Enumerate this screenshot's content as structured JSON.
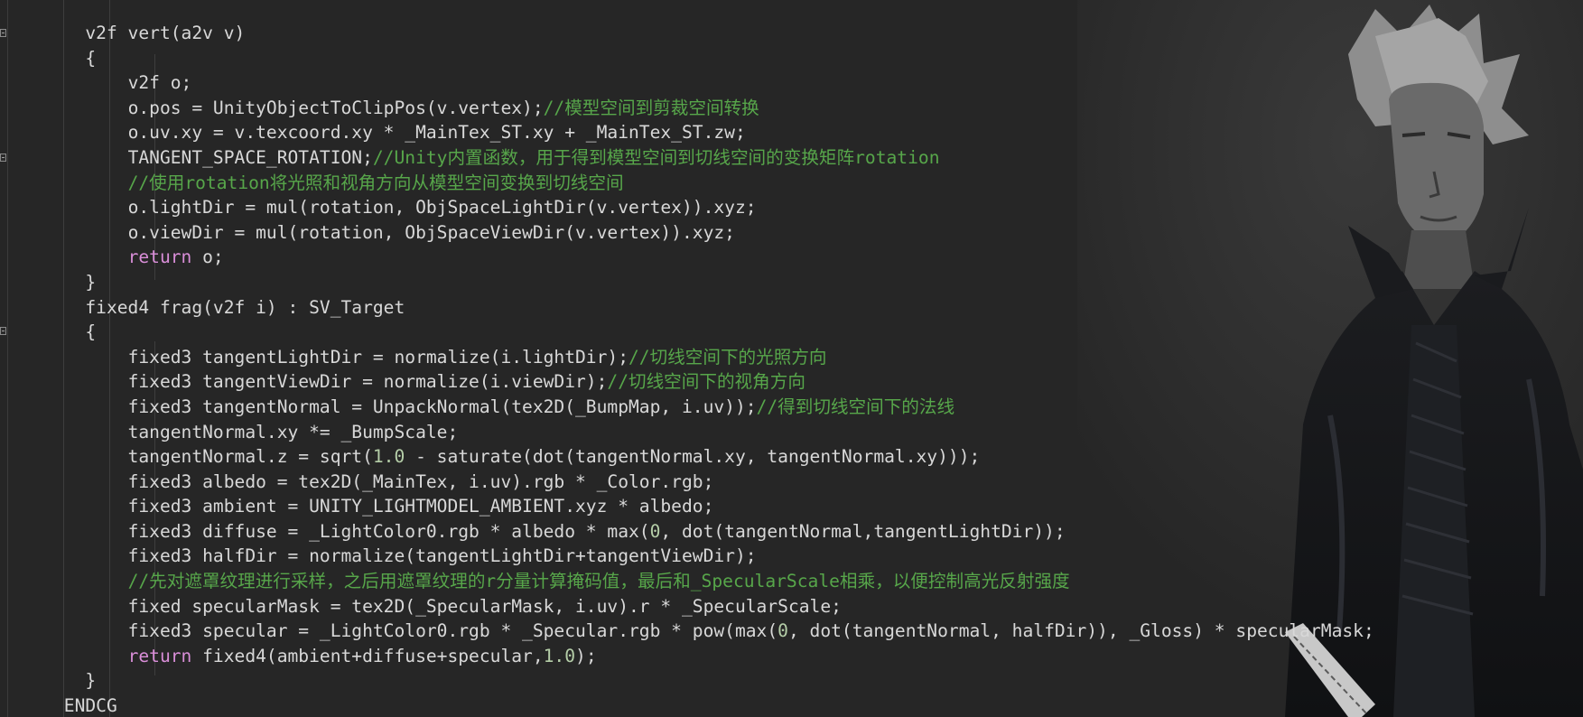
{
  "editor": {
    "theme_colors": {
      "background": "#262626",
      "text": "#d8d8d8",
      "comment": "#57a64a",
      "keyword": "#d98ed8"
    },
    "background_image": "character-artwork",
    "lines": [
      {
        "indent": "        ",
        "segments": [
          {
            "t": "v2f vert(a2v v)",
            "c": "code"
          }
        ]
      },
      {
        "indent": "        ",
        "segments": [
          {
            "t": "{",
            "c": "code"
          }
        ]
      },
      {
        "indent": "            ",
        "segments": [
          {
            "t": "v2f o;",
            "c": "code"
          }
        ]
      },
      {
        "indent": "            ",
        "segments": [
          {
            "t": "o.pos = UnityObjectToClipPos(v.vertex);",
            "c": "code"
          },
          {
            "t": "//模型空间到剪裁空间转换",
            "c": "cmt"
          }
        ]
      },
      {
        "indent": "            ",
        "segments": [
          {
            "t": "o.uv.xy = v.texcoord.xy * _MainTex_ST.xy + _MainTex_ST.zw;",
            "c": "code"
          }
        ]
      },
      {
        "indent": "            ",
        "segments": [
          {
            "t": "TANGENT_SPACE_ROTATION;",
            "c": "code"
          },
          {
            "t": "//Unity内置函数，用于得到模型空间到切线空间的变换矩阵rotation",
            "c": "cmt"
          }
        ]
      },
      {
        "indent": "            ",
        "segments": [
          {
            "t": "//使用rotation将光照和视角方向从模型空间变换到切线空间",
            "c": "cmt"
          }
        ]
      },
      {
        "indent": "            ",
        "segments": [
          {
            "t": "o.lightDir = mul(rotation, ObjSpaceLightDir(v.vertex)).xyz;",
            "c": "code"
          }
        ]
      },
      {
        "indent": "            ",
        "segments": [
          {
            "t": "o.viewDir = mul(rotation, ObjSpaceViewDir(v.vertex)).xyz;",
            "c": "code"
          }
        ]
      },
      {
        "indent": "            ",
        "segments": [
          {
            "t": "return",
            "c": "kw"
          },
          {
            "t": " o;",
            "c": "code"
          }
        ]
      },
      {
        "indent": "        ",
        "segments": [
          {
            "t": "}",
            "c": "code"
          }
        ]
      },
      {
        "indent": "        ",
        "segments": [
          {
            "t": "fixed4 frag(v2f i) : SV_Target",
            "c": "code"
          }
        ]
      },
      {
        "indent": "        ",
        "segments": [
          {
            "t": "{",
            "c": "code"
          }
        ]
      },
      {
        "indent": "            ",
        "segments": [
          {
            "t": "fixed3 tangentLightDir = normalize(i.lightDir);",
            "c": "code"
          },
          {
            "t": "//切线空间下的光照方向",
            "c": "cmt"
          }
        ]
      },
      {
        "indent": "            ",
        "segments": [
          {
            "t": "fixed3 tangentViewDir = normalize(i.viewDir);",
            "c": "code"
          },
          {
            "t": "//切线空间下的视角方向",
            "c": "cmt"
          }
        ]
      },
      {
        "indent": "            ",
        "segments": [
          {
            "t": "fixed3 tangentNormal = UnpackNormal(tex2D(_BumpMap, i.uv));",
            "c": "code"
          },
          {
            "t": "//得到切线空间下的法线",
            "c": "cmt"
          }
        ]
      },
      {
        "indent": "            ",
        "segments": [
          {
            "t": "tangentNormal.xy *= _BumpScale;",
            "c": "code"
          }
        ]
      },
      {
        "indent": "            ",
        "segments": [
          {
            "t": "tangentNormal.z = sqrt(",
            "c": "code"
          },
          {
            "t": "1.0",
            "c": "num"
          },
          {
            "t": " - saturate(dot(tangentNormal.xy, tangentNormal.xy)));",
            "c": "code"
          }
        ]
      },
      {
        "indent": "            ",
        "segments": [
          {
            "t": "fixed3 albedo = tex2D(_MainTex, i.uv).rgb * _Color.rgb;",
            "c": "code"
          }
        ]
      },
      {
        "indent": "            ",
        "segments": [
          {
            "t": "fixed3 ambient = UNITY_LIGHTMODEL_AMBIENT.xyz * albedo;",
            "c": "code"
          }
        ]
      },
      {
        "indent": "            ",
        "segments": [
          {
            "t": "fixed3 diffuse = _LightColor0.rgb * albedo * max(",
            "c": "code"
          },
          {
            "t": "0",
            "c": "num"
          },
          {
            "t": ", dot(tangentNormal,tangentLightDir));",
            "c": "code"
          }
        ]
      },
      {
        "indent": "            ",
        "segments": [
          {
            "t": "fixed3 halfDir = normalize(tangentLightDir+tangentViewDir);",
            "c": "code"
          }
        ]
      },
      {
        "indent": "            ",
        "segments": [
          {
            "t": "//先对遮罩纹理进行采样，之后用遮罩纹理的r分量计算掩码值，最后和_SpecularScale相乘，以便控制高光反射强度",
            "c": "cmt"
          }
        ]
      },
      {
        "indent": "            ",
        "segments": [
          {
            "t": "fixed specularMask = tex2D(_SpecularMask, i.uv).r * _SpecularScale;",
            "c": "code"
          }
        ]
      },
      {
        "indent": "            ",
        "segments": [
          {
            "t": "fixed3 specular = _LightColor0.rgb * _Specular.rgb * pow(max(",
            "c": "code"
          },
          {
            "t": "0",
            "c": "num"
          },
          {
            "t": ", dot(tangentNormal, halfDir)), _Gloss) * specularMask;",
            "c": "code"
          }
        ]
      },
      {
        "indent": "            ",
        "segments": [
          {
            "t": "return",
            "c": "kw"
          },
          {
            "t": " fixed4(ambient+diffuse+specular,",
            "c": "code"
          },
          {
            "t": "1.0",
            "c": "num"
          },
          {
            "t": ");",
            "c": "code"
          }
        ]
      },
      {
        "indent": "        ",
        "segments": [
          {
            "t": "}",
            "c": "code"
          }
        ]
      },
      {
        "indent": "      ",
        "segments": [
          {
            "t": "ENDCG",
            "c": "code"
          }
        ]
      }
    ]
  }
}
